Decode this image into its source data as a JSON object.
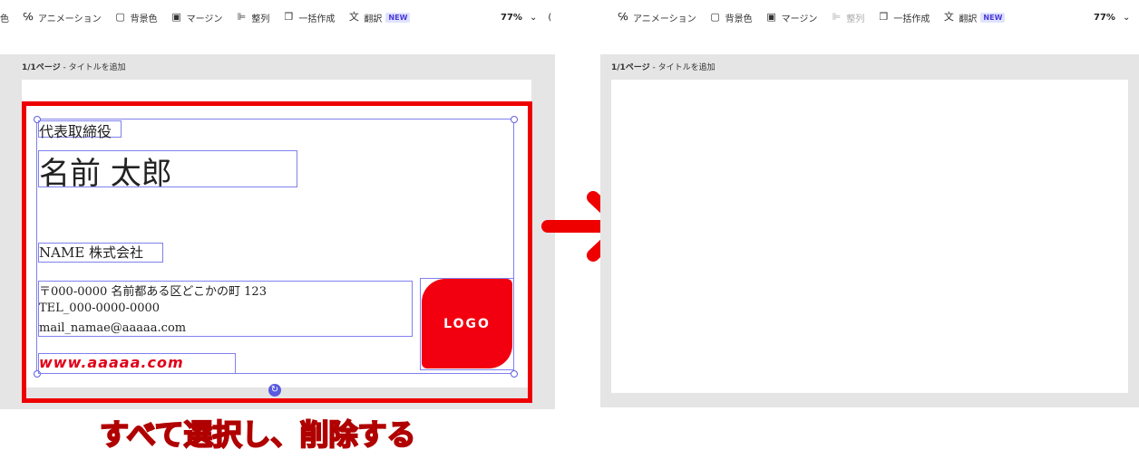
{
  "left_toolbar": {
    "items": [
      {
        "icon": "color-icon",
        "label": "色"
      },
      {
        "icon": "animation-icon",
        "label": "アニメーション"
      },
      {
        "icon": "background-color-icon",
        "label": "背景色"
      },
      {
        "icon": "margin-icon",
        "label": "マージン"
      },
      {
        "icon": "align-icon",
        "label": "整列"
      },
      {
        "icon": "bulk-create-icon",
        "label": "一括作成"
      },
      {
        "icon": "translate-icon",
        "label": "翻訳",
        "badge": "NEW"
      }
    ],
    "zoom": "77%"
  },
  "right_toolbar": {
    "items": [
      {
        "icon": "animation-icon",
        "label": "アニメーション"
      },
      {
        "icon": "background-color-icon",
        "label": "背景色"
      },
      {
        "icon": "margin-icon",
        "label": "マージン"
      },
      {
        "icon": "align-icon",
        "label": "整列",
        "disabled": true
      },
      {
        "icon": "bulk-create-icon",
        "label": "一括作成"
      },
      {
        "icon": "translate-icon",
        "label": "翻訳",
        "badge": "NEW"
      }
    ],
    "zoom": "77%"
  },
  "left_page": {
    "page_number": "1/1ページ",
    "title_placeholder": " - タイトルを追加"
  },
  "right_page": {
    "page_number": "1/1ページ",
    "title_placeholder": " - タイトルを追加"
  },
  "card": {
    "job_title": "代表取締役",
    "name": "名前 太郎",
    "company": "NAME 株式会社",
    "address": "〒000-0000 名前都ある区どこかの町 123",
    "tel": "TEL_000-0000-0000",
    "mail": "mail_namae@aaaaa.com",
    "logo": "LOGO",
    "url": "www.aaaaa.com"
  },
  "caption": "すべて選択し、削除する",
  "colors": {
    "highlight": "#ee0000",
    "selection": "#8080ee",
    "logo": "#f2000f",
    "arrow": "#ee0000"
  }
}
